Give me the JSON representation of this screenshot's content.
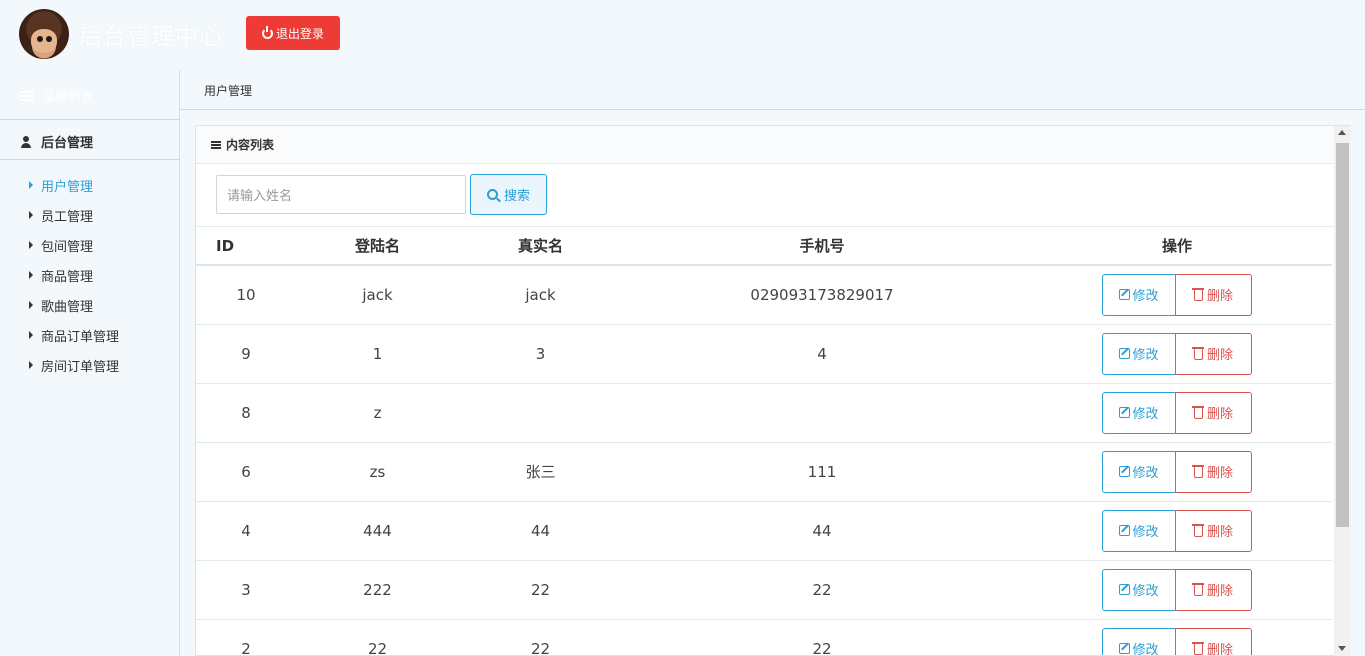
{
  "header": {
    "title": "后台管理中心",
    "logout_label": "退出登录",
    "logout_icon": "power-icon"
  },
  "sidebar": {
    "menu_heading": "菜单列表",
    "section_title": "后台管理",
    "items": [
      {
        "label": "用户管理",
        "active": true
      },
      {
        "label": "员工管理",
        "active": false
      },
      {
        "label": "包间管理",
        "active": false
      },
      {
        "label": "商品管理",
        "active": false
      },
      {
        "label": "歌曲管理",
        "active": false
      },
      {
        "label": "商品订单管理",
        "active": false
      },
      {
        "label": "房间订单管理",
        "active": false
      }
    ]
  },
  "breadcrumb": {
    "current": "用户管理"
  },
  "panel": {
    "title": "内容列表",
    "search": {
      "placeholder": "请输入姓名",
      "value": "",
      "button_label": "搜索"
    }
  },
  "table": {
    "headers": {
      "id": "ID",
      "login": "登陆名",
      "real": "真实名",
      "phone": "手机号",
      "op": "操作"
    },
    "edit_label": "修改",
    "delete_label": "删除",
    "rows": [
      {
        "id": "10",
        "login": "jack",
        "real": "jack",
        "phone": "029093173829017"
      },
      {
        "id": "9",
        "login": "1",
        "real": "3",
        "phone": "4"
      },
      {
        "id": "8",
        "login": "z",
        "real": "",
        "phone": ""
      },
      {
        "id": "6",
        "login": "zs",
        "real": "张三",
        "phone": "111"
      },
      {
        "id": "4",
        "login": "444",
        "real": "44",
        "phone": "44"
      },
      {
        "id": "3",
        "login": "222",
        "real": "22",
        "phone": "22"
      },
      {
        "id": "2",
        "login": "22",
        "real": "22",
        "phone": "22"
      }
    ]
  },
  "colors": {
    "accent": "#2a9fd6",
    "danger": "#d9534f",
    "logout": "#ef3b35",
    "background": "#f2f8fc"
  }
}
